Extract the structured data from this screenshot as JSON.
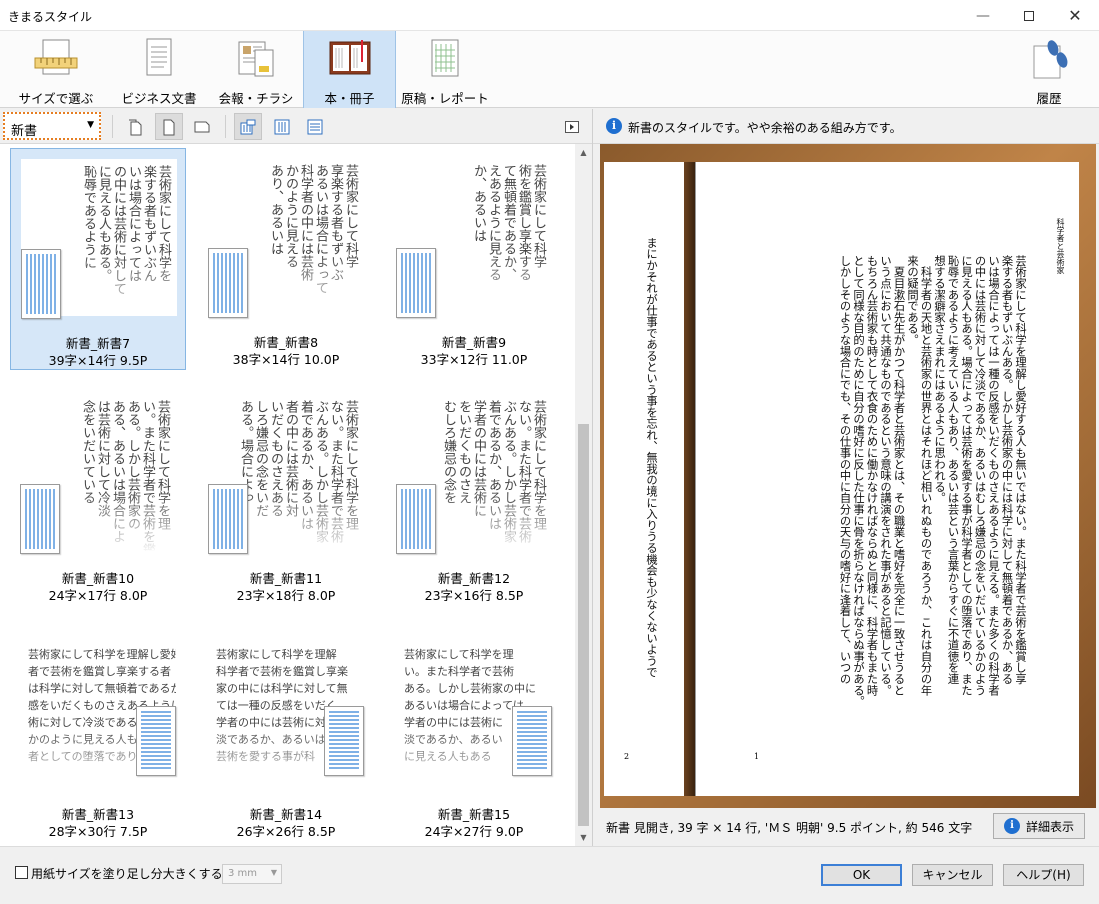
{
  "window": {
    "title": "きまるスタイル"
  },
  "ribbon": [
    {
      "label": "サイズで選ぶ",
      "icon": "ruler-icon"
    },
    {
      "label": "ビジネス文書",
      "icon": "document-icon"
    },
    {
      "label": "会報・チラシ",
      "icon": "newsletter-icon"
    },
    {
      "label": "本・冊子",
      "icon": "book-icon",
      "active": true
    },
    {
      "label": "原稿・レポート",
      "icon": "manuscript-icon"
    },
    {
      "label": "履歴",
      "icon": "footprints-icon"
    }
  ],
  "toolbar": {
    "category_value": "新書"
  },
  "styles": [
    {
      "name": "新書_新書7",
      "info": "39字×14行  9.5P",
      "text": "芸術家にして科学を\n楽する者もずいぶん\nいは場合によっては\nの中には芸術に対して\nに見える人もある。\n恥辱であるように",
      "orient": "vertical",
      "selected": true
    },
    {
      "name": "新書_新書8",
      "info": "38字×14行  10.0P",
      "text": "芸術家にして科学\n享楽する者もずいぶ\nあるいは場合によって\n科学者の中には芸術\nかのように見える\nあり、あるいは",
      "orient": "vertical"
    },
    {
      "name": "新書_新書9",
      "info": "33字×12行  11.0P",
      "text": "芸術家にして科学\n術を鑑賞し享楽する\nて無頓着であるか、\nえあるように見える\nか、あるいは",
      "orient": "vertical"
    },
    {
      "name": "新書_新書10",
      "info": "24字×17行  8.0P",
      "text": "芸術家にして科学を理\nい。また科学者で芸術を鑑\nある。しかし芸術家の\nある、あるいは場合によ\nは芸術に対して冷淡\n念をいだいている",
      "orient": "vertical"
    },
    {
      "name": "新書_新書11",
      "info": "23字×18行  8.0P",
      "text": "芸術家にして科学を理\nない。また科学者で芸術\nぶんある。しかし芸術家\n着であるか、あるいは\n者の中には芸術に対\nいだくものさえある\nしろ嫌忌の念をいだ\nある。場合によっ",
      "orient": "vertical"
    },
    {
      "name": "新書_新書12",
      "info": "23字×16行  8.5P",
      "text": "芸術家にして科学を理\nない。また科学者で芸術\nぶんある。しかし芸術家\n着であるか、あるいは\n学者の中には芸術に\nをいだくものさえ\nむしろ嫌忌の念を",
      "orient": "vertical"
    },
    {
      "name": "新書_新書13",
      "info": "28字×30行  7.5P",
      "text": "芸術家にして科学を理解し愛好\n者で芸術を鑑賞し享楽する者\nは科学に対して無頓着であるか\n感をいだくものさえあるように見\n術に対して冷淡であるか、あ\nかのように見える人もある\n者としての堕落であり",
      "orient": "horizontal"
    },
    {
      "name": "新書_新書14",
      "info": "26字×26行  8.5P",
      "text": "芸術家にして科学を理解\n科学者で芸術を鑑賞し享楽\n家の中には科学に対して無\nては一種の反感をいだく\n学者の中には芸術に対\n淡であるか、あるいは\n芸術を愛する事が科",
      "orient": "horizontal"
    },
    {
      "name": "新書_新書15",
      "info": "24字×27行  9.0P",
      "text": "芸術家にして科学を理\nい。また科学者で芸術\nある。しかし芸術家の中に\nあるいは場合によっては\n学者の中には芸術に\n淡であるか、あるい\nに見える人もある",
      "orient": "horizontal"
    }
  ],
  "preview": {
    "description": "新書のスタイルです。やや余裕のある組み方です。",
    "heading": "科学者と芸術家",
    "right_page_lines": [
      "芸術家にして科学を理解し愛好する人も無いではない。また科学者で芸術を鑑賞し享",
      "楽する者もずいぶんある。しかし芸術家の中には科学に対して無頓着であるか、ある",
      "いは場合によっては一種の反感をいだくものさえあるように見える。また多くの科学者",
      "の中には芸術に対して冷淡であるか、あるいはむしろ嫌忌の念をいだいているかのよう",
      "に見える人もある。場合によっては芸術を愛する事が科学者としての堕落であり、また",
      "恥辱であるように考えている人もあり、あるいは芸という言葉からすぐに不道徳を連",
      "想する潔癖家さえまれにはあるように思われる。",
      "　科学者の天地と芸術家の世界とはそれほど相いれぬものであろうか、これは自分の年",
      "来の疑問である。",
      "　夏目漱石先生がかつて科学者と芸術家とは、その職業と嗜好を完全に一致させうると",
      "いう点において共通なものであるという意味の講演をされた事があると記憶している。",
      "もちろん芸術家も時として衣食のために働かなければならぬと同様に、科学者もまた時",
      "として同様な目的のために自分の嗜好に反した仕事に骨を折らなければならぬ事がある。",
      "しかしそのような場合にでも、その仕事の中に自分の天与の嗜好に逢着して、いつの"
    ],
    "left_page_lines": [
      "まにかそれが仕事であるという事を忘れ、無我の境に入りうる機会も少なくないようで"
    ],
    "page_right_num": "1",
    "page_left_num": "2",
    "status": "新書 見開き,  39 字 × 14 行,  'ＭＳ 明朝' 9.5 ポイント,  約 546 文字",
    "detail_button": "詳細表示"
  },
  "footer": {
    "checkbox_label": "用紙サイズを塗り足し分大きくする(S)",
    "bleed_value": "3 mm",
    "ok": "OK",
    "cancel": "キャンセル",
    "help": "ヘルプ(H)"
  }
}
